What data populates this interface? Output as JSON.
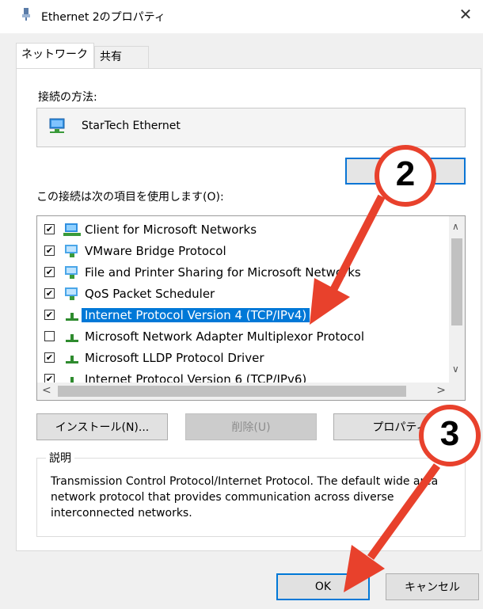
{
  "window": {
    "title": "Ethernet 2のプロパティ",
    "close_glyph": "✕"
  },
  "tabs": [
    {
      "label": "ネットワーク"
    },
    {
      "label": "共有"
    }
  ],
  "connection": {
    "label": "接続の方法:",
    "adapter_name": "StarTech Ethernet"
  },
  "items_label": "この接続は次の項目を使用します(O):",
  "items": [
    {
      "label": "Client for Microsoft Networks",
      "checked": true,
      "icon": "network-client-icon"
    },
    {
      "label": "VMware Bridge Protocol",
      "checked": true,
      "icon": "network-service-icon"
    },
    {
      "label": "File and Printer Sharing for Microsoft Networks",
      "checked": true,
      "icon": "network-service-icon"
    },
    {
      "label": "QoS Packet Scheduler",
      "checked": true,
      "icon": "network-service-icon"
    },
    {
      "label": "Internet Protocol Version 4 (TCP/IPv4)",
      "checked": true,
      "selected": true,
      "icon": "protocol-icon"
    },
    {
      "label": "Microsoft Network Adapter Multiplexor Protocol",
      "checked": false,
      "icon": "protocol-icon"
    },
    {
      "label": "Microsoft LLDP Protocol Driver",
      "checked": true,
      "icon": "protocol-icon"
    },
    {
      "label": "Internet Protocol Version 6 (TCP/IPv6)",
      "checked": true,
      "icon": "protocol-icon"
    }
  ],
  "buttons": {
    "install": "インストール(N)...",
    "remove": "削除(U)",
    "properties": "プロパティ",
    "ok": "OK",
    "cancel": "キャンセル"
  },
  "description": {
    "label": "説明",
    "text": "Transmission Control Protocol/Internet Protocol. The default wide area network protocol that provides communication across diverse interconnected networks."
  },
  "annotations": [
    {
      "number": "2"
    },
    {
      "number": "3"
    }
  ],
  "colors": {
    "annotation_red": "#e8412c",
    "selection_blue": "#0078d7"
  }
}
